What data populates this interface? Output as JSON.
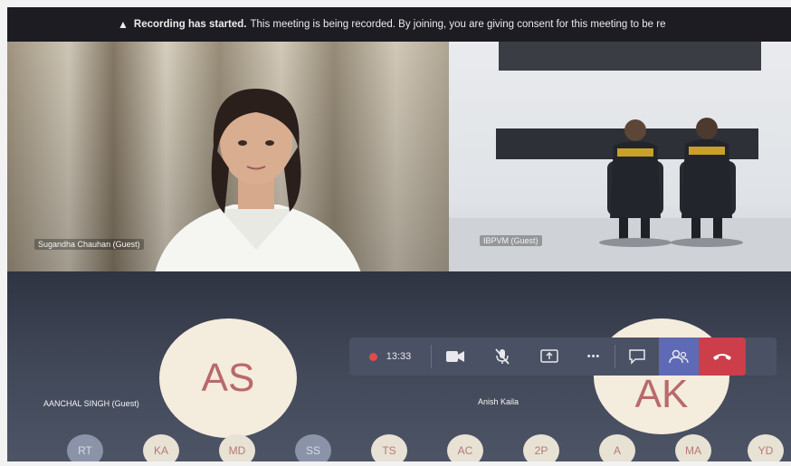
{
  "banner": {
    "title": "Recording has started.",
    "message": "This meeting is being recorded. By joining, you are giving consent for this meeting to be re"
  },
  "tiles": [
    {
      "name": "Sugandha Chauhan (Guest)"
    },
    {
      "name": "IBPVM (Guest)"
    }
  ],
  "stage": {
    "big_avatars": [
      {
        "initials": "AS",
        "label": "AANCHAL SINGH (Guest)"
      },
      {
        "initials": "AK",
        "label": "Anish Kaila"
      }
    ]
  },
  "controls": {
    "timer": "13:33",
    "icons": [
      "camera-icon",
      "mic-off-icon",
      "share-icon",
      "more-icon",
      "chat-icon",
      "participants-icon",
      "hang-up-icon"
    ],
    "more_label": "•••"
  },
  "participants": [
    "RT",
    "KA",
    "MD",
    "SS",
    "TS",
    "AC",
    "2P",
    "A",
    "MA",
    "YD"
  ],
  "colors": {
    "end_call": "#cc3e4a",
    "active": "#5e6ab5",
    "record": "#e14b4b"
  }
}
